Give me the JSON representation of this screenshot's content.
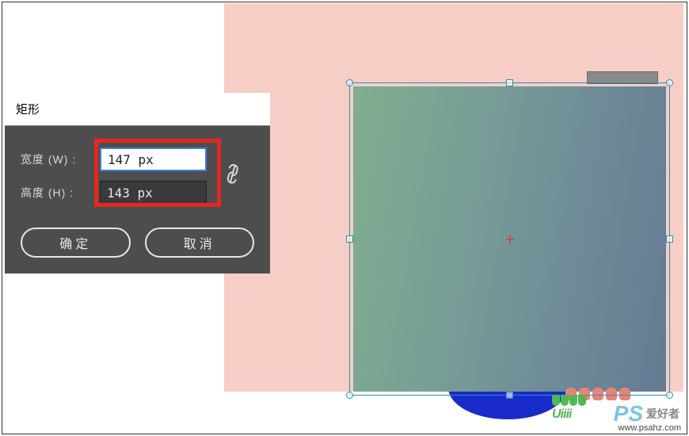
{
  "dialog": {
    "title": "矩形",
    "width_label": "宽度 (W) :",
    "height_label": "高度 (H) :",
    "width_value": "147 px",
    "height_value": "143 px",
    "ok_label": "确定",
    "cancel_label": "取消"
  },
  "watermark": {
    "url": "www.psahz.com",
    "ps": "PS",
    "ps_sub": "爱好者",
    "uiii": "Uiiii"
  }
}
